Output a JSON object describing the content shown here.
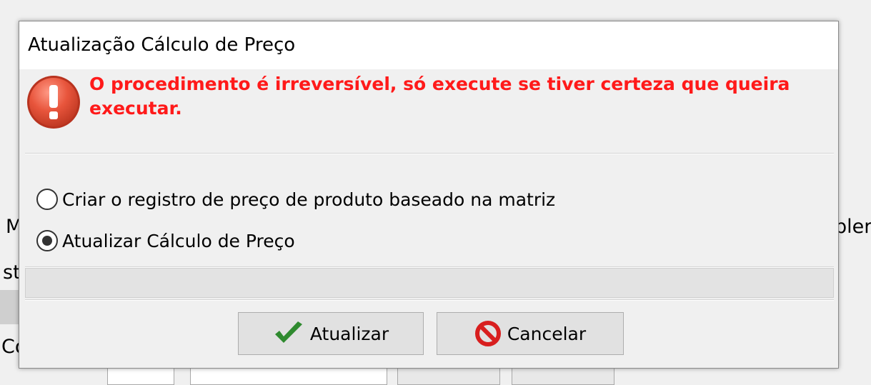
{
  "background": {
    "frag_m": "M",
    "frag_st": "st",
    "frag_co": "Co",
    "frag_pler": "pler"
  },
  "dialog": {
    "title": "Atualização Cálculo de Preço",
    "warning_icon": "exclamation-icon",
    "warning_text": "O procedimento é irreversível, só execute se tiver certeza que queira executar.",
    "warning_color": "#ff1a1a",
    "options": [
      {
        "label": "Criar o registro de preço de produto baseado na matriz",
        "selected": false
      },
      {
        "label": "Atualizar Cálculo de Preço",
        "selected": true
      }
    ],
    "buttons": {
      "ok_label": "Atualizar",
      "ok_icon": "checkmark-icon",
      "cancel_label": "Cancelar",
      "cancel_icon": "prohibited-icon"
    }
  }
}
